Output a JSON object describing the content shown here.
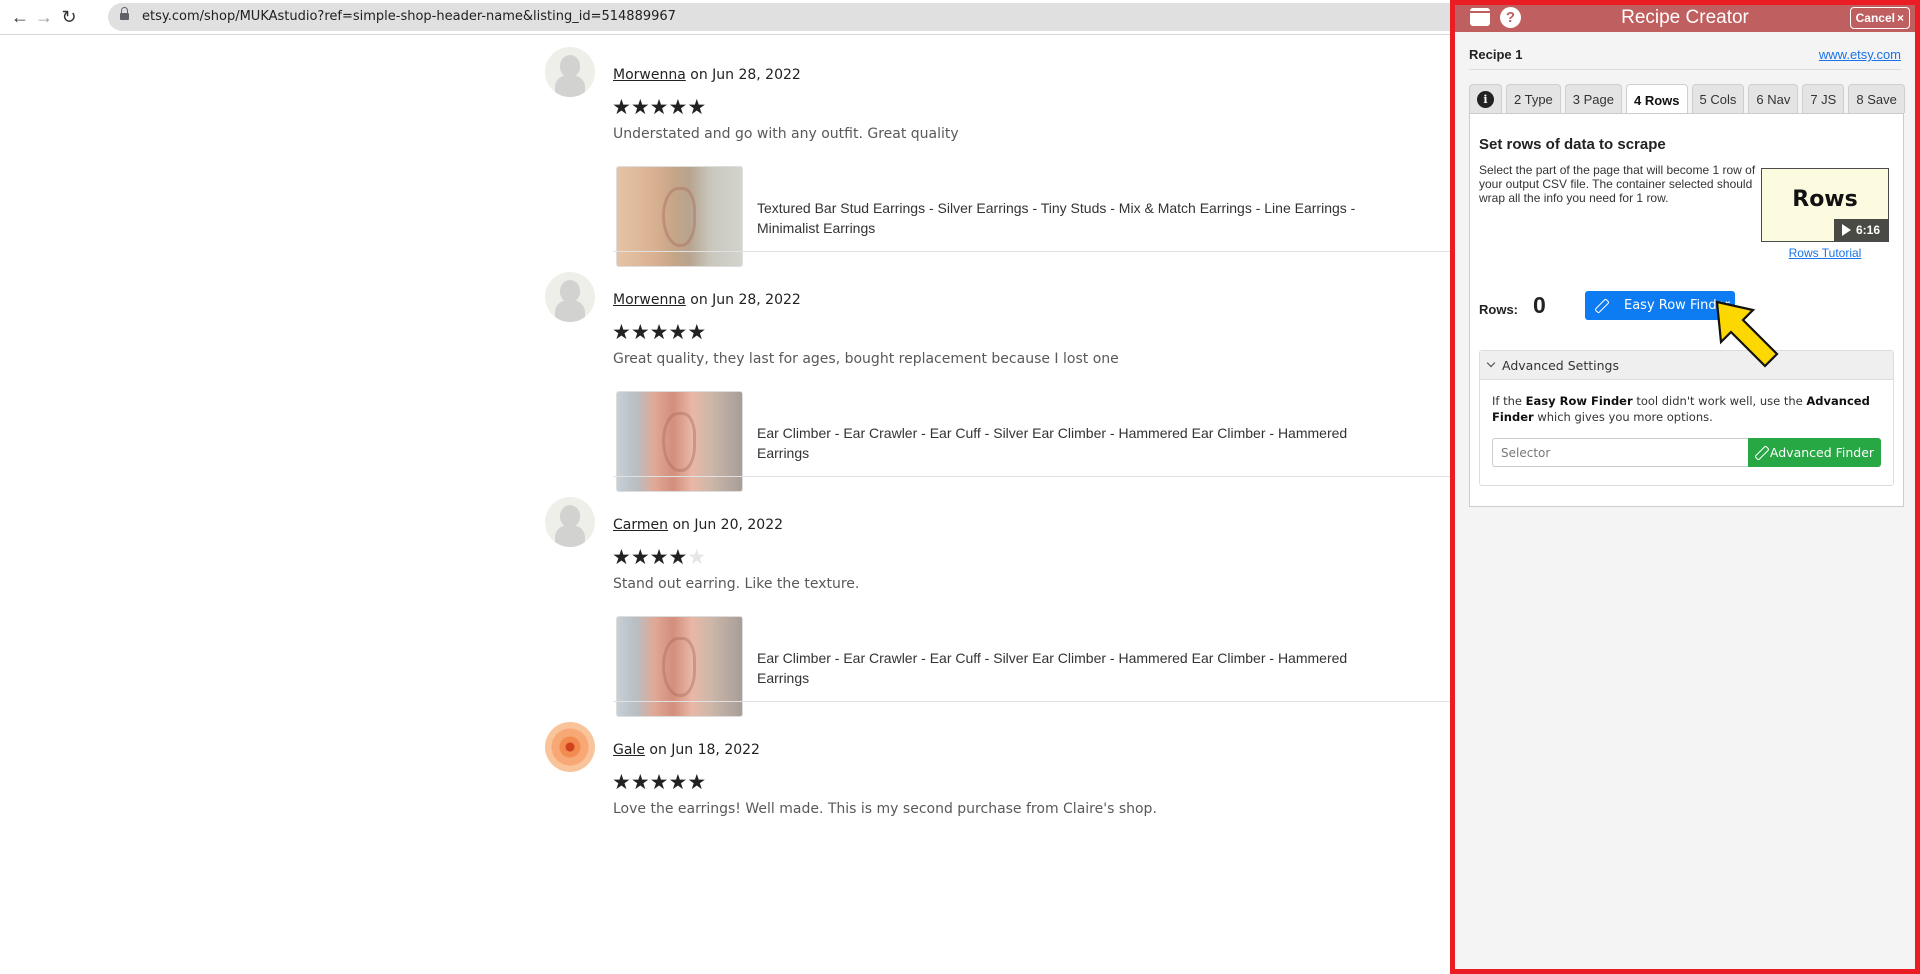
{
  "browser": {
    "url": "etsy.com/shop/MUKAstudio?ref=simple-shop-header-name&listing_id=514889967",
    "back_icon": "arrow-left-icon",
    "forward_icon": "arrow-right-icon",
    "reload_icon": "reload-icon"
  },
  "reviews": [
    {
      "reviewer": "Morwenna",
      "date_text": " on Jun 28, 2022",
      "rating": 5,
      "max_rating": 5,
      "text": "Understated and go with any outfit. Great quality",
      "product_title": "Textured Bar Stud Earrings - Silver Earrings - Tiny Studs - Mix & Match Earrings - Line Earrings - Minimalist Earrings",
      "avatar": "default-avatar"
    },
    {
      "reviewer": "Morwenna",
      "date_text": " on Jun 28, 2022",
      "rating": 5,
      "max_rating": 5,
      "text": "Great quality, they last for ages, bought replacement because I lost one",
      "product_title": "Ear Climber - Ear Crawler - Ear Cuff - Silver Ear Climber - Hammered Ear Climber - Hammered Earrings",
      "avatar": "default-avatar"
    },
    {
      "reviewer": "Carmen",
      "date_text": " on Jun 20, 2022",
      "rating": 4,
      "max_rating": 5,
      "text": "Stand out earring. Like the texture.",
      "product_title": "Ear Climber - Ear Crawler - Ear Cuff - Silver Ear Climber - Hammered Ear Climber - Hammered Earrings",
      "avatar": "default-avatar"
    },
    {
      "reviewer": "Gale",
      "date_text": " on Jun 18, 2022",
      "rating": 5,
      "max_rating": 5,
      "text": "Love the earrings! Well made. This is my second purchase from Claire's shop.",
      "avatar": "rose-avatar"
    }
  ],
  "panel": {
    "title": "Recipe Creator",
    "cancel_label": "Cancel",
    "cancel_icon": "×",
    "help_icon": "?",
    "recipe_name": "Recipe 1",
    "site_link": "www.etsy.com",
    "tabs": [
      {
        "label": "i",
        "icon": "info-icon"
      },
      {
        "label": "2 Type"
      },
      {
        "label": "3 Page"
      },
      {
        "label": "4 Rows",
        "active": true
      },
      {
        "label": "5 Cols"
      },
      {
        "label": "6 Nav"
      },
      {
        "label": "7 JS"
      },
      {
        "label": "8 Save"
      }
    ],
    "section_title": "Set rows of data to scrape",
    "section_desc": "Select the part of the page that will become 1 row of your output CSV file. The container selected should wrap all the info you need for 1 row.",
    "video": {
      "label": "Rows",
      "duration": "6:16"
    },
    "tutorial_link": "Rows Tutorial",
    "rows_label": "Rows:",
    "rows_count": "0",
    "easy_row_finder_label": "Easy Row Finder",
    "advanced": {
      "header": "Advanced Settings",
      "text_pre": "If the ",
      "text_bold1": "Easy Row Finder",
      "text_mid": " tool didn't work well, use the ",
      "text_bold2": "Advanced Finder",
      "text_post": " which gives you more options.",
      "selector_placeholder": "Selector",
      "selector_value": "",
      "advanced_finder_label": "Advanced Finder"
    }
  },
  "colors": {
    "panel_border": "#ec1c24",
    "panel_header": "#c05f5f",
    "primary_button": "#0d7cf2",
    "success_button": "#28a745",
    "pointer_arrow": "#fcd800"
  }
}
